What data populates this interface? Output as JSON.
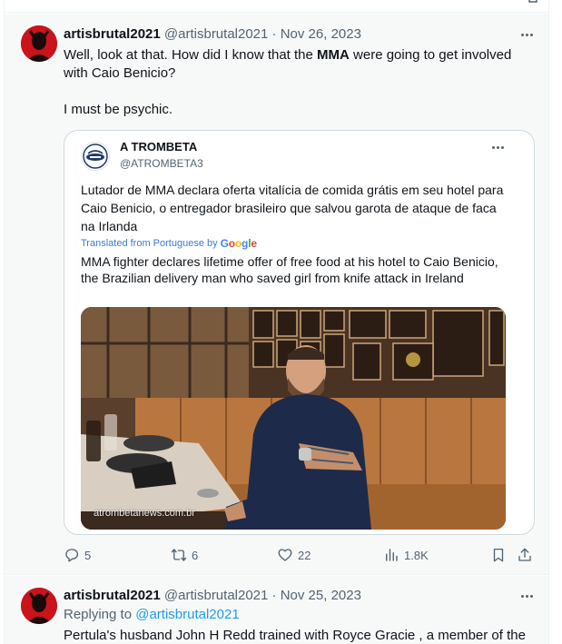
{
  "colors": {
    "text_primary": "#0f1419",
    "text_secondary": "#536471",
    "link": "#1d9bf0",
    "tweet_bg": "#f7f9f9",
    "border": "#cfd9de",
    "avatar_red": "#c8141a"
  },
  "tweet1": {
    "author_name": "artisbrutal2021",
    "author_handle": "@artisbrutal2021",
    "separator": "·",
    "date": "Nov 26, 2023",
    "text_line1_pre": "Well, look at that.  How did I know that the ",
    "text_line1_bold": "MMA",
    "text_line1_post": " were going to get involved with Caio Benicio?",
    "text_line2": "I must be psychic.",
    "quote": {
      "author_name": "A TROMBETA",
      "author_handle": "@ATROMBETA3",
      "original_text": "Lutador de MMA declara oferta vitalícia de comida grátis em seu hotel para Caio Benicio, o entregador brasileiro que salvou garota de ataque de faca na Irlanda",
      "translated_label": "Translated from Portuguese by",
      "translated_by": {
        "g1": "G",
        "o1": "o",
        "o2": "o",
        "g2": "g",
        "l": "l",
        "e": "e"
      },
      "translated_text": "MMA fighter declares lifetime offer of free food at his hotel to Caio Benicio, the Brazilian delivery man who saved girl from knife attack in Ireland",
      "image_watermark": "atrombetanews.com.br"
    },
    "actions": {
      "replies": "5",
      "retweets": "6",
      "likes": "22",
      "views": "1.8K"
    }
  },
  "tweet2": {
    "author_name": "artisbrutal2021",
    "author_handle": "@artisbrutal2021",
    "separator": "·",
    "date": "Nov 25, 2023",
    "replying_label": "Replying to ",
    "replying_mention": "@artisbrutal2021",
    "text": "Pertula's husband John H Redd trained with Royce Gracie , a member of the"
  },
  "icons": [
    "more-icon",
    "reply-icon",
    "retweet-icon",
    "like-icon",
    "views-icon",
    "bookmark-icon",
    "share-icon"
  ]
}
